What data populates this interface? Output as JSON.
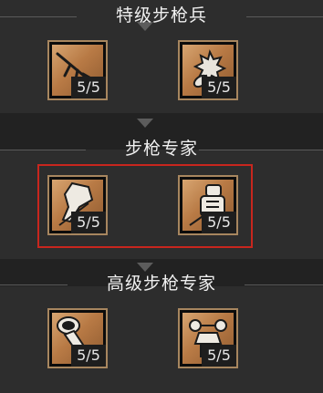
{
  "tiers": [
    {
      "title": "特级步枪兵",
      "skills": [
        {
          "icon": "assault-rifle-icon",
          "count": "5/5"
        },
        {
          "icon": "grenade-rocket-icon",
          "count": "5/5"
        }
      ]
    },
    {
      "title": "步枪专家",
      "skills": [
        {
          "icon": "prone-shooter-icon",
          "count": "5/5"
        },
        {
          "icon": "armored-soldier-icon",
          "count": "5/5"
        }
      ]
    },
    {
      "title": "高级步枪专家",
      "skills": [
        {
          "icon": "launcher-tube-icon",
          "count": "5/5"
        },
        {
          "icon": "aiming-soldier-icon",
          "count": "5/5"
        }
      ]
    }
  ],
  "colors": {
    "frame": "#a7865f",
    "highlight": "#c8261e",
    "art": "#c08048"
  }
}
